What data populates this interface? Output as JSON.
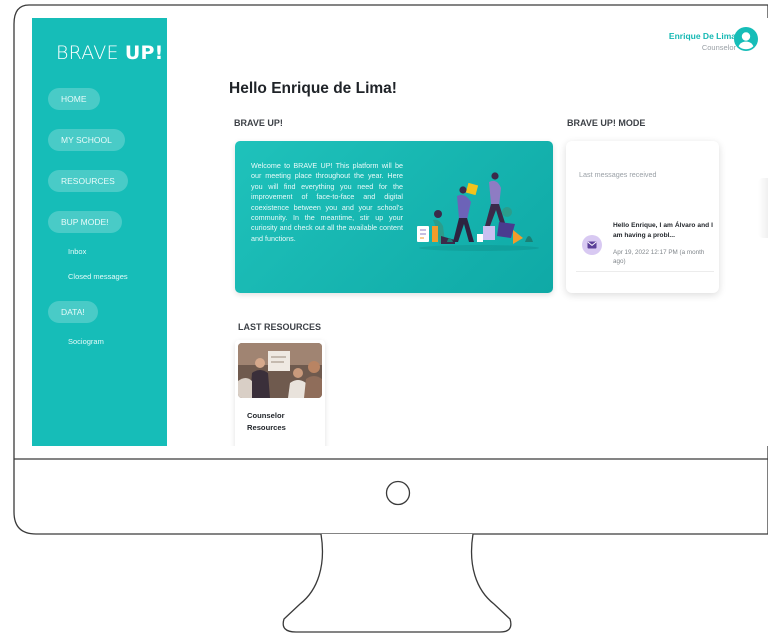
{
  "app": {
    "logo_light": "BRAVE ",
    "logo_bold": "UP!"
  },
  "sidebar": {
    "items": [
      {
        "label": "HOME"
      },
      {
        "label": "MY SCHOOL"
      },
      {
        "label": "RESOURCES"
      },
      {
        "label": "BUP MODE!"
      },
      {
        "label": "DATA!"
      }
    ],
    "subitems": {
      "inbox": "Inbox",
      "closed_messages": "Closed messages",
      "sociogram": "Sociogram"
    }
  },
  "user": {
    "name": "Enrique De Lima",
    "role": "Counselor",
    "avatar_icon": "user-circle-icon"
  },
  "main": {
    "greeting": "Hello Enrique de Lima!",
    "section_brave_up": "BRAVE UP!",
    "section_mode": "BRAVE UP! MODE",
    "welcome_text": "Welcome to BRAVE UP! This platform will be our meeting place throughout the year. Here you will find everything you need for the improvement of face-to-face and digital coexistence between you and your school's community. In the meantime, stir up your curiosity and check out all the available content and functions.",
    "messages": {
      "title": "Last messages received",
      "item_text": "Hello Enrique, I am Álvaro and I am having a probl...",
      "item_date": "Apr 19, 2022 12:17 PM (a month ago)",
      "item_icon": "envelope-icon"
    },
    "resources": {
      "title": "LAST RESOURCES",
      "card_label": "Counselor Resources"
    }
  },
  "colors": {
    "brand_teal": "#16bdb8",
    "accent_purple": "#8e7cc3",
    "text_dark": "#1f2328"
  }
}
